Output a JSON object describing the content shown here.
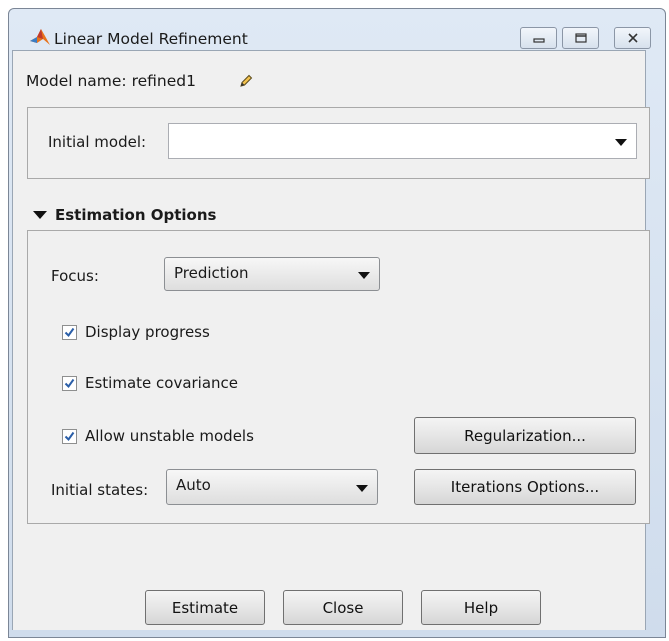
{
  "window": {
    "title": "Linear Model Refinement",
    "controls": [
      "minimize",
      "maximize",
      "close"
    ]
  },
  "model": {
    "name_text": "Model name: refined1"
  },
  "initial_model": {
    "label": "Initial model:",
    "value": ""
  },
  "estimation": {
    "section_title": "Estimation Options",
    "focus_label": "Focus:",
    "focus_value": "Prediction",
    "display_progress": {
      "label": "Display progress",
      "checked": true
    },
    "estimate_covariance": {
      "label": "Estimate covariance",
      "checked": true
    },
    "allow_unstable": {
      "label": "Allow unstable models",
      "checked": true
    },
    "initial_states_label": "Initial states:",
    "initial_states_value": "Auto",
    "regularization_button": "Regularization...",
    "iterations_button": "Iterations Options..."
  },
  "footer": {
    "estimate_button": "Estimate",
    "close_button": "Close",
    "help_button": "Help"
  },
  "colors": {
    "accent_check": "#2a5ea8",
    "panel_bg": "#f0f0f0",
    "titlebar": "#d6e2f0"
  }
}
